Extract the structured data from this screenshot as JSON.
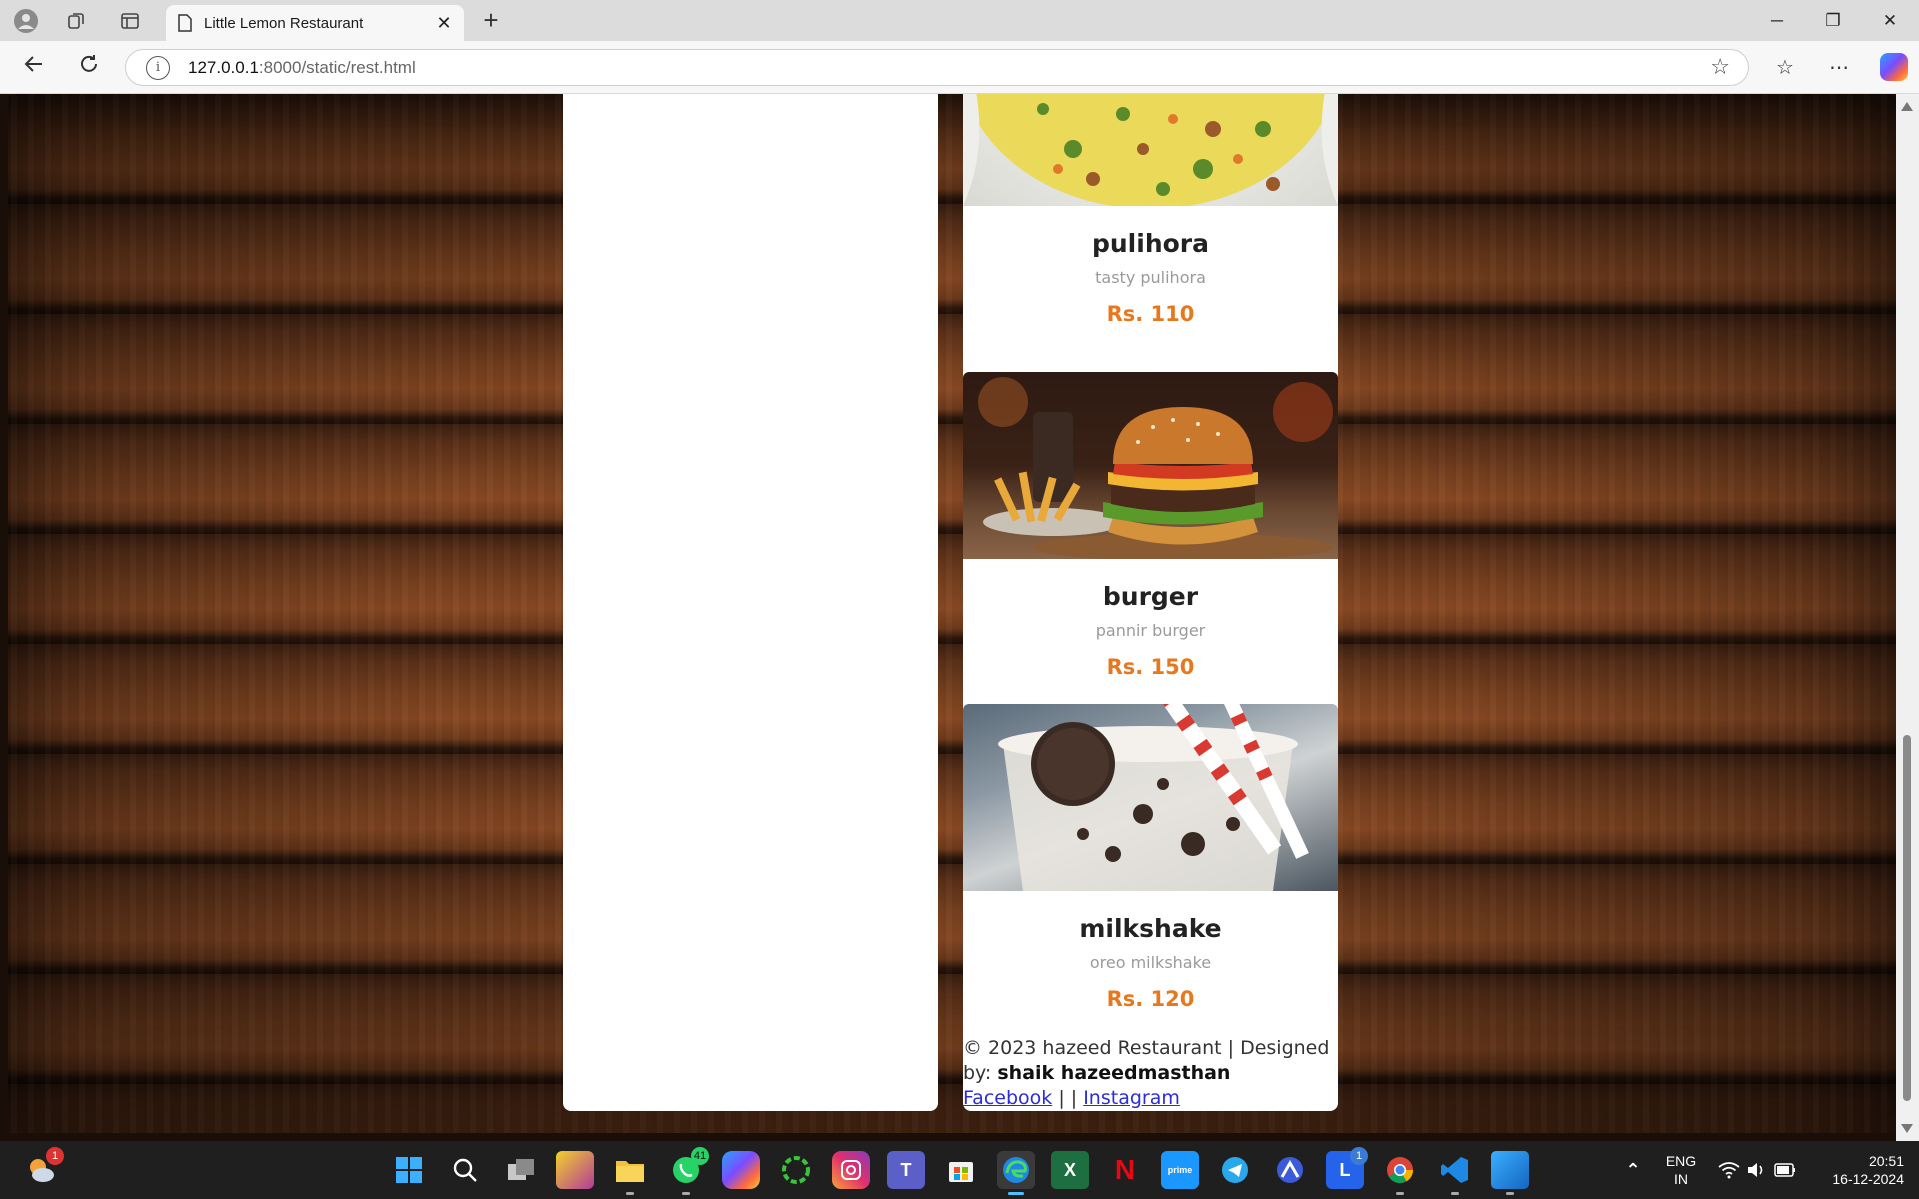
{
  "browser": {
    "tab_title": "Little Lemon Restaurant",
    "url_host": "127.0.0.1",
    "url_path": ":8000/static/rest.html",
    "close_glyph": "✕",
    "new_tab_glyph": "+",
    "minimize_glyph": "─",
    "restore_glyph": "❐",
    "window_close_glyph": "✕"
  },
  "menu": [
    {
      "name": "pulihora",
      "description": "tasty pulihora",
      "price": "Rs. 110",
      "image": "rice"
    },
    {
      "name": "burger",
      "description": "pannir burger",
      "price": "Rs. 150",
      "image": "burger"
    },
    {
      "name": "milkshake",
      "description": "oreo milkshake",
      "price": "Rs. 120",
      "image": "shake"
    }
  ],
  "footer": {
    "copyright": "© 2023 hazeed Restaurant | Designed by: ",
    "designer": "shaik hazeedmasthan",
    "facebook": "Facebook",
    "separator": " | | ",
    "instagram": "Instagram"
  },
  "colors": {
    "price": "#e8781d",
    "link": "#2b2bdc",
    "accent": "#4cc2ff"
  },
  "taskbar": {
    "weather_badge": "1",
    "whatsapp_badge": "41",
    "l_badge": "1",
    "lang_top": "ENG",
    "lang_bottom": "IN",
    "time": "20:51",
    "date": "16-12-2024"
  }
}
